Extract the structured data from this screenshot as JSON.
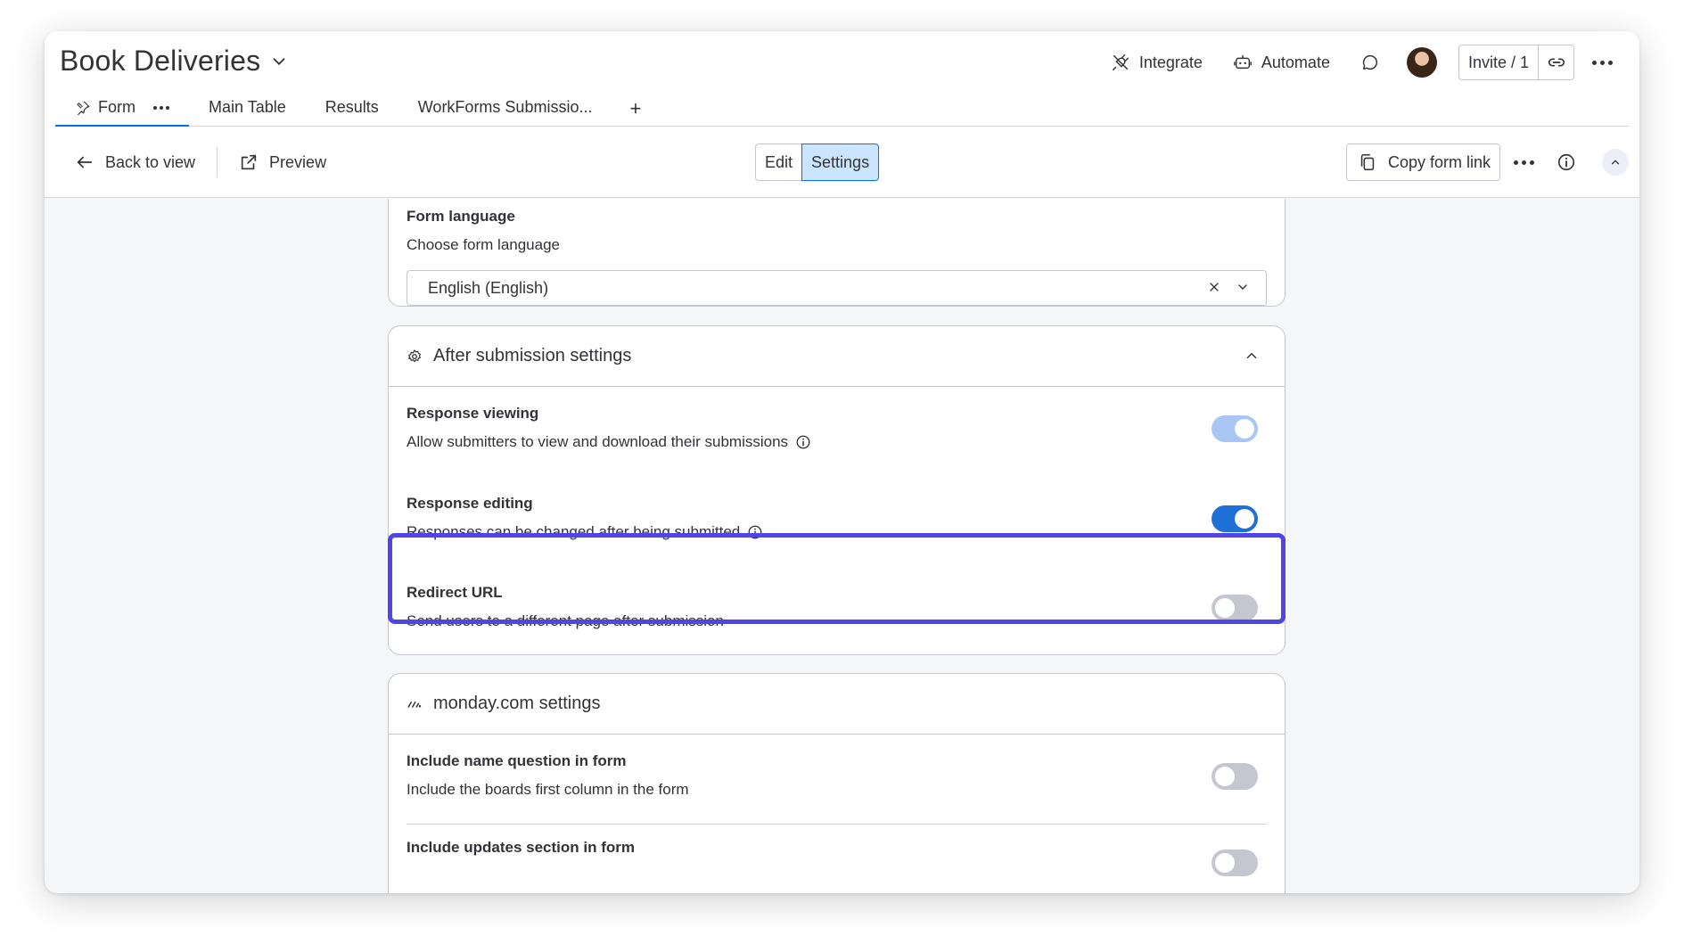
{
  "header": {
    "board_title": "Book Deliveries",
    "actions": {
      "integrate": "Integrate",
      "automate": "Automate",
      "invite": "Invite / 1"
    }
  },
  "tabs": [
    {
      "label": "Form",
      "active": true
    },
    {
      "label": "Main Table"
    },
    {
      "label": "Results"
    },
    {
      "label": "WorkForms Submissio..."
    }
  ],
  "tab_add": "+",
  "toolbar": {
    "back": "Back to view",
    "preview": "Preview",
    "edit": "Edit",
    "settings": "Settings",
    "copy_link": "Copy form link"
  },
  "form_language": {
    "title": "Form language",
    "description": "Choose form language",
    "value": "English (English)"
  },
  "after_submission": {
    "title": "After submission settings",
    "rows": [
      {
        "title": "Response viewing",
        "description": "Allow submitters to view and download their submissions",
        "enabled": true,
        "dimmed": true
      },
      {
        "title": "Response editing",
        "description": "Responses can be changed after being submitted",
        "enabled": true
      },
      {
        "title": "Redirect URL",
        "description": "Send users to a different page after submission",
        "enabled": false
      }
    ]
  },
  "monday_settings": {
    "title": "monday.com settings",
    "rows": [
      {
        "title": "Include name question in form",
        "description": "Include the boards first column in the form",
        "enabled": false
      },
      {
        "title": "Include updates section in form",
        "description": "",
        "enabled": false
      }
    ]
  },
  "colors": {
    "accent": "#0073ea",
    "toggle_on": "#1f6fd9",
    "toggle_on_dimmed": "#a9c6f5",
    "toggle_off": "#c5c7d0",
    "highlight": "#5046e5"
  }
}
